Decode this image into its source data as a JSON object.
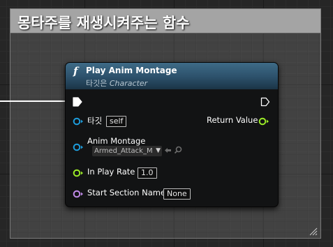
{
  "comment": {
    "title": "몽타주를 재생시켜주는 함수"
  },
  "node": {
    "icon": "function-icon",
    "title": "Play Anim Montage",
    "subtitle_prefix": "타깃은 ",
    "subtitle_target": "Character",
    "pins": {
      "target_label": "타깃",
      "target_value": "self",
      "anim_montage_label": "Anim Montage",
      "anim_montage_value": "Armed_Attack_M",
      "play_rate_label": "In Play Rate",
      "play_rate_value": "1.0",
      "start_section_label": "Start Section Name",
      "start_section_value": "None",
      "return_label": "Return Value"
    }
  },
  "colors": {
    "header": "#2c506a",
    "object_pin": "#1d9cdb",
    "float_pin": "#9bea27",
    "name_pin": "#c08ae8",
    "exec_pin": "#ffffff"
  }
}
